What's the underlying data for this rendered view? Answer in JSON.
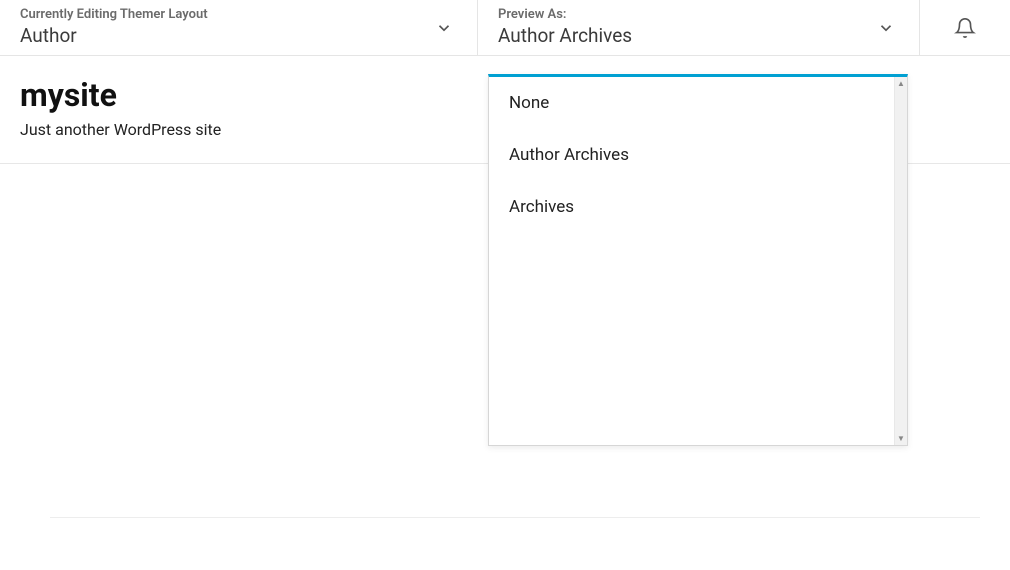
{
  "header": {
    "editing": {
      "label": "Currently Editing Themer Layout",
      "value": "Author"
    },
    "preview": {
      "label": "Preview As:",
      "value": "Author Archives"
    }
  },
  "site": {
    "title": "mysite",
    "tagline": "Just another WordPress site"
  },
  "dropdown": {
    "items": [
      {
        "label": "None"
      },
      {
        "label": "Author Archives"
      },
      {
        "label": "Archives"
      }
    ]
  }
}
